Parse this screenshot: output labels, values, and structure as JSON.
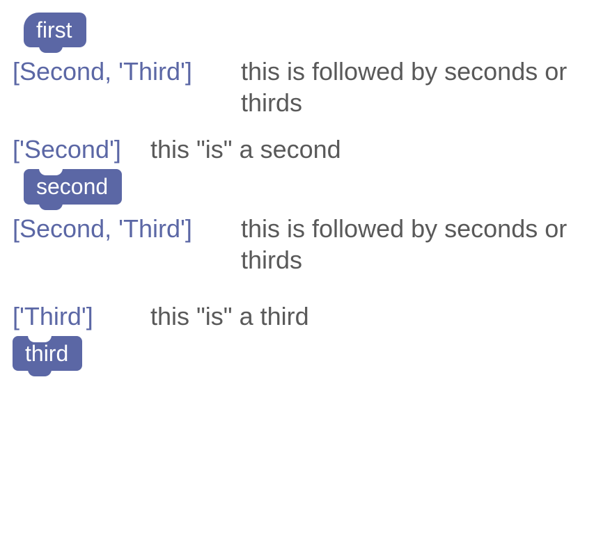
{
  "blocks": {
    "first": "first",
    "second": "second",
    "third": "third"
  },
  "rows": [
    {
      "next": "[Second, 'Third']",
      "desc": "this is followed by seconds or thirds"
    },
    {
      "next": "['Second']",
      "desc": "this \"is\" a second"
    },
    {
      "next": "[Second, 'Third']",
      "desc": "this is followed by seconds or thirds"
    },
    {
      "next": "['Third']",
      "desc": "this \"is\" a third"
    }
  ]
}
